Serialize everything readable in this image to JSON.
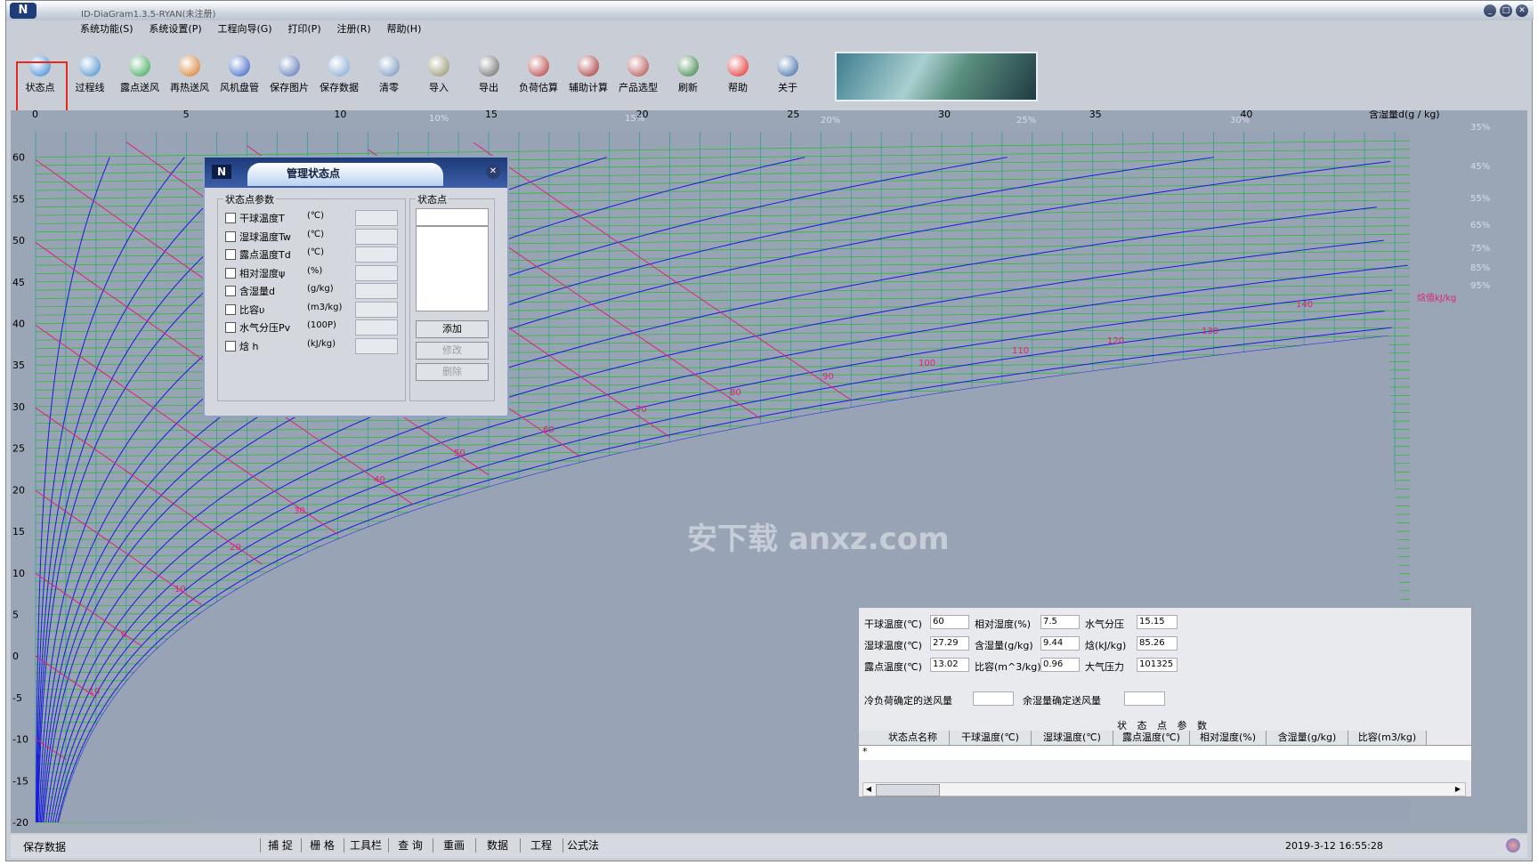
{
  "window": {
    "title": "ID-DiaGram1.3.5-RYAN(未注册)"
  },
  "menu": [
    "系统功能(S)",
    "系统设置(P)",
    "工程向导(G)",
    "打印(P)",
    "注册(R)",
    "帮助(H)"
  ],
  "toolbar": [
    {
      "label": "状态点",
      "icon": "state-point-icon",
      "color": "#2f7fd0"
    },
    {
      "label": "过程线",
      "icon": "process-line-icon",
      "color": "#3a86c8"
    },
    {
      "label": "露点送风",
      "icon": "dewpoint-supply-icon",
      "color": "#2aa04a"
    },
    {
      "label": "再热送风",
      "icon": "reheat-supply-icon",
      "color": "#d0701a"
    },
    {
      "label": "风机盘管",
      "icon": "fan-coil-icon",
      "color": "#2a56c0"
    },
    {
      "label": "保存图片",
      "icon": "save-image-icon",
      "color": "#4a6ab0"
    },
    {
      "label": "保存数据",
      "icon": "save-data-icon",
      "color": "#7aa0d0"
    },
    {
      "label": "清零",
      "icon": "clear-icon",
      "color": "#6a8ab8"
    },
    {
      "label": "导入",
      "icon": "import-icon",
      "color": "#8a8a60"
    },
    {
      "label": "导出",
      "icon": "export-icon",
      "color": "#606060"
    },
    {
      "label": "负荷估算",
      "icon": "load-estimate-icon",
      "color": "#b03030"
    },
    {
      "label": "辅助计算",
      "icon": "aux-calc-icon",
      "color": "#a02828"
    },
    {
      "label": "产品选型",
      "icon": "product-select-icon",
      "color": "#b04040"
    },
    {
      "label": "刷新",
      "icon": "refresh-icon",
      "color": "#2a7a3a"
    },
    {
      "label": "帮助",
      "icon": "help-icon",
      "color": "#e02020"
    },
    {
      "label": "关于",
      "icon": "about-icon",
      "color": "#3060a0"
    }
  ],
  "chart": {
    "xlabel": "含湿量d(g / kg)",
    "x_ticks": [
      "0",
      "5",
      "10",
      "15",
      "20",
      "25",
      "30",
      "35",
      "40"
    ],
    "y_ticks": [
      "60",
      "55",
      "50",
      "45",
      "40",
      "35",
      "30",
      "25",
      "20",
      "15",
      "10",
      "5",
      "0",
      "-5",
      "-10",
      "-15",
      "-20"
    ],
    "rh_labels": [
      "10%",
      "15%",
      "20%",
      "25%",
      "30%",
      "35%",
      "45%",
      "55%",
      "65%",
      "75%",
      "85%",
      "95%"
    ],
    "h_labels": [
      "-10",
      "0",
      "10",
      "20",
      "30",
      "40",
      "50",
      "60",
      "70",
      "80",
      "90",
      "100",
      "110",
      "120",
      "130",
      "140"
    ],
    "h_axis_label": "焓值kJ/kg",
    "colors": {
      "rh": "#1a1adc",
      "enthalpy": "#e0207a",
      "temp": "#20c020",
      "grid": "#0a9a9a"
    }
  },
  "watermark": "安下载 anxz.com",
  "dialog": {
    "title": "管理状态点",
    "params_group": "状态点参数",
    "points_group": "状态点",
    "params": [
      {
        "label": "干球温度T",
        "unit": "(℃)"
      },
      {
        "label": "湿球温度Tw",
        "unit": "(℃)"
      },
      {
        "label": "露点温度Td",
        "unit": "(℃)"
      },
      {
        "label": "相对湿度ψ",
        "unit": "(%)"
      },
      {
        "label": "含湿量d",
        "unit": "(g/kg)"
      },
      {
        "label": "比容υ",
        "unit": "(m3/kg)"
      },
      {
        "label": "水气分压Pv",
        "unit": "(100P)"
      },
      {
        "label": "焓 h",
        "unit": "(kJ/kg)"
      }
    ],
    "buttons": {
      "add": "添加",
      "edit": "修改",
      "delete": "删除"
    }
  },
  "info": {
    "dry_bulb_label": "干球温度(℃)",
    "dry_bulb": "60",
    "rh_label": "相对湿度(%)",
    "rh": "7.5",
    "pv_label": "水气分压",
    "pv": "15.15",
    "wet_bulb_label": "湿球温度(℃)",
    "wet_bulb": "27.29",
    "d_label": "含湿量(g/kg)",
    "d": "9.44",
    "h_label": "焓(kJ/kg)",
    "h": "85.26",
    "dew_label": "露点温度(℃)",
    "dew": "13.02",
    "v_label": "比容(m^3/kg)",
    "v": "0.96",
    "p_label": "大气压力",
    "p": "101325",
    "cool_label": "冷负荷确定的送风量",
    "moist_label": "余湿量确定送风量",
    "table_caption": "状 态 点 参 数",
    "columns": [
      "状态点名称",
      "干球温度(℃)",
      "湿球温度(℃)",
      "露点温度(℃)",
      "相对湿度(%)",
      "含湿量(g/kg)",
      "比容(m3/kg)"
    ],
    "new_row_marker": "*"
  },
  "status": {
    "left": "保存数据",
    "tabs": [
      "捕 捉",
      "栅 格",
      "工具栏",
      "查 询",
      "重画",
      "数据",
      "工程",
      "公式法"
    ],
    "datetime": "2019-3-12 16:55:28"
  }
}
